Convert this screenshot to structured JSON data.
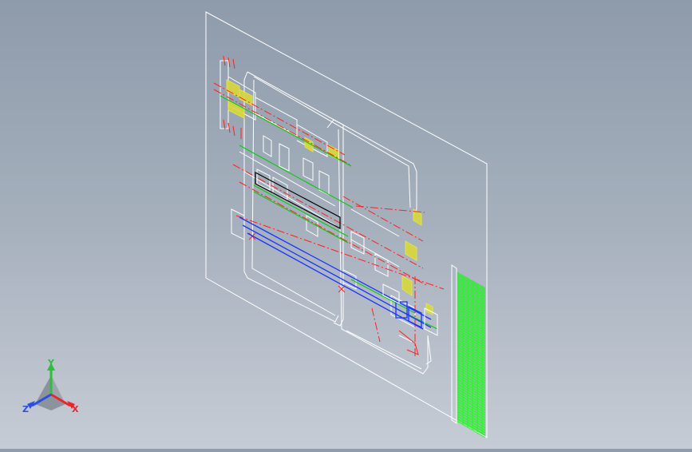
{
  "viewport": {
    "background_top": "#8e9bab",
    "background_bottom": "#c6ccd5"
  },
  "drawing": {
    "line_colors": {
      "frame": "#ffffff",
      "center_line": "#ff2020",
      "shaft": "#00cc00",
      "feed_shaft": "#1a33ff",
      "hatch": "#e8e840",
      "table": "#19ff19",
      "outline": "#000000"
    }
  },
  "triad": {
    "x_label": "X",
    "y_label": "Y",
    "z_label": "Z",
    "x_color": "#e8262c",
    "y_color": "#2fbf3f",
    "z_color": "#2b4fe0"
  }
}
